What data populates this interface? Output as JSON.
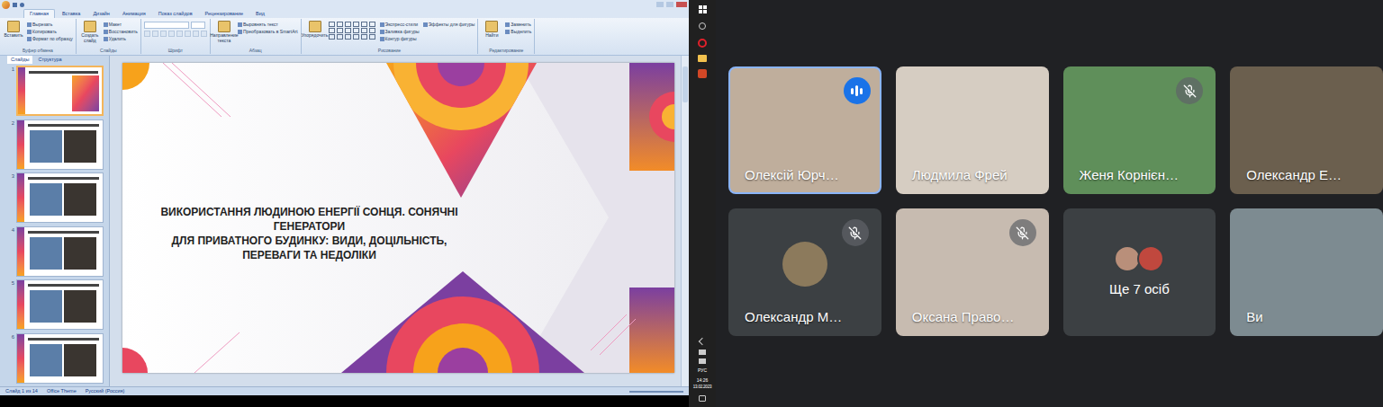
{
  "powerpoint": {
    "ribbon_tabs": [
      {
        "label": "Главная",
        "selected": true
      },
      {
        "label": "Вставка",
        "selected": false
      },
      {
        "label": "Дизайн",
        "selected": false
      },
      {
        "label": "Анимация",
        "selected": false
      },
      {
        "label": "Показ слайдов",
        "selected": false
      },
      {
        "label": "Рецензирование",
        "selected": false
      },
      {
        "label": "Вид",
        "selected": false
      }
    ],
    "ribbon_groups": [
      {
        "label": "Буфер обмена",
        "items": [
          "Вставить",
          "Вырезать",
          "Копировать",
          "Формат по образцу"
        ]
      },
      {
        "label": "Слайды",
        "items": [
          "Создать слайд",
          "Макет",
          "Восстановить",
          "Удалить"
        ]
      },
      {
        "label": "Шрифт",
        "items": []
      },
      {
        "label": "Абзац",
        "items": [
          "Направление текста",
          "Выровнять текст",
          "Преобразовать в SmartArt"
        ]
      },
      {
        "label": "Рисование",
        "items": [
          "Упорядочить",
          "Экспресс-стили",
          "Заливка фигуры",
          "Контур фигуры",
          "Эффекты для фигуры"
        ]
      },
      {
        "label": "Редактирование",
        "items": [
          "Найти",
          "Заменить",
          "Выделить"
        ]
      }
    ],
    "panel_tabs": [
      {
        "label": "Слайды",
        "selected": true
      },
      {
        "label": "Структура",
        "selected": false
      }
    ],
    "thumbnails": [
      {
        "number": "1",
        "selected": true
      },
      {
        "number": "2",
        "selected": false
      },
      {
        "number": "3",
        "selected": false
      },
      {
        "number": "4",
        "selected": false
      },
      {
        "number": "5",
        "selected": false
      },
      {
        "number": "6",
        "selected": false
      }
    ],
    "slide": {
      "title_lines": [
        "ВИКОРИСТАННЯ ЛЮДИНОЮ ЕНЕРГІЇ СОНЦЯ. СОНЯЧНІ",
        "ГЕНЕРАТОРИ",
        "ДЛЯ ПРИВАТНОГО БУДИНКУ: ВИДИ, ДОЦІЛЬНІСТЬ,",
        "ПЕРЕВАГИ ТА НЕДОЛІКИ"
      ]
    },
    "status_bar": [
      "Слайд 1 из 14",
      "Office Theme",
      "Русский (Россия)"
    ]
  },
  "taskbar": {
    "language": "РУС",
    "time": "14:26",
    "date": "13.02.2023"
  },
  "participants": [
    {
      "name": "Олексій Юрч…",
      "kind": "video",
      "muted": false,
      "speaking": true,
      "color": "#bfae9c"
    },
    {
      "name": "Людмила Фрей",
      "kind": "video",
      "muted": false,
      "speaking": false,
      "color": "#d6cdc2"
    },
    {
      "name": "Женя Корнієн…",
      "kind": "video",
      "muted": true,
      "speaking": false,
      "color": "#5f8f5a"
    },
    {
      "name": "Олександр Е…",
      "kind": "video",
      "muted": false,
      "speaking": false,
      "color": "#6b5f4e"
    },
    {
      "name": "Олександр М…",
      "kind": "avatar",
      "muted": true,
      "speaking": false,
      "color": "#8c7a5c"
    },
    {
      "name": "Оксана Право…",
      "kind": "video",
      "muted": true,
      "speaking": false,
      "color": "#c7bbb0"
    },
    {
      "name": "Ще 7 осіб",
      "kind": "more",
      "muted": false,
      "speaking": false,
      "color": "#3c4043"
    },
    {
      "name": "Ви",
      "kind": "video",
      "muted": false,
      "speaking": false,
      "color": "#7d8b91"
    }
  ]
}
